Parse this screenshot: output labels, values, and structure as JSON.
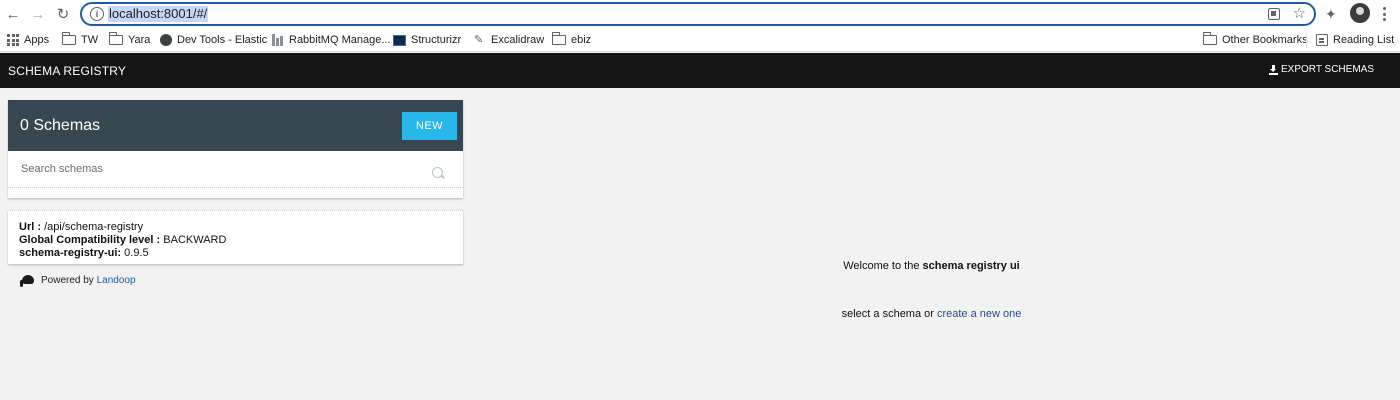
{
  "browser": {
    "url": "localhost:8001/#/",
    "bookmarks": [
      {
        "label": "Apps",
        "icon": "apps-grid-icon"
      },
      {
        "label": "TW",
        "icon": "folder-icon"
      },
      {
        "label": "Yara",
        "icon": "folder-icon"
      },
      {
        "label": "Dev Tools - Elastic",
        "icon": "globe-icon"
      },
      {
        "label": "RabbitMQ Manage...",
        "icon": "rabbitmq-icon"
      },
      {
        "label": "Structurizr",
        "icon": "structurizr-icon"
      },
      {
        "label": "Excalidraw",
        "icon": "excalidraw-icon"
      },
      {
        "label": "ebiz",
        "icon": "folder-icon"
      }
    ],
    "other_bookmarks": "Other Bookmarks",
    "reading_list": "Reading List"
  },
  "app": {
    "title": "SCHEMA REGISTRY",
    "export_label": "EXPORT SCHEMAS"
  },
  "schemas": {
    "count_label": "0 Schemas",
    "new_label": "NEW",
    "search_placeholder": "Search schemas"
  },
  "info": {
    "url_label": "Url :",
    "url_value": "/api/schema-registry",
    "compat_label": "Global Compatibility level :",
    "compat_value": "BACKWARD",
    "version_label": "schema-registry-ui:",
    "version_value": "0.9.5"
  },
  "footer": {
    "powered_by": "Powered by",
    "powered_link": "Landoop"
  },
  "welcome": {
    "prefix": "Welcome to the",
    "bold": "schema registry ui",
    "select_text": "select a schema or",
    "create_link": "create a new one"
  },
  "colors": {
    "header_bg": "#151515",
    "card_head_bg": "#37474f",
    "accent": "#29b6e8",
    "link": "#2b4f7a"
  }
}
